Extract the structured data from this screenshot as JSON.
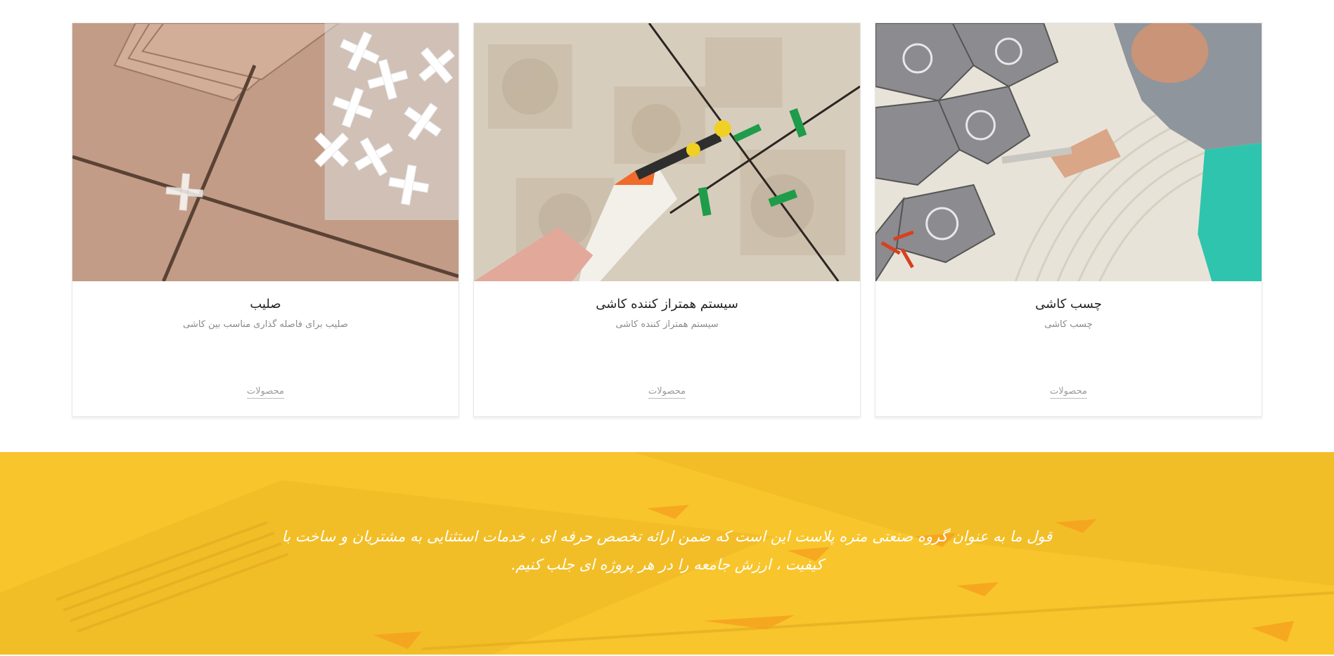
{
  "cards": [
    {
      "title": "صلیب",
      "description": "صلیب برای فاصله گذاری مناسب بین کاشی",
      "link_label": "محصولات",
      "image_icon": "tile-spacer-crosses-image"
    },
    {
      "title": "سیستم همتراز کننده کاشی",
      "description": "سیستم همتراز کننده کاشی",
      "link_label": "محصولات",
      "image_icon": "tile-leveling-system-image"
    },
    {
      "title": "چسب کاشی",
      "description": "چسب کاشی",
      "link_label": "محصولات",
      "image_icon": "tile-adhesive-image"
    }
  ],
  "banner": {
    "text": "قول ما به عنوان گروه صنعتی متره پلاست این است که ضمن ارائه تخصص حرفه ای ، خدمات استثنایی به مشتریان و ساخت با کیفیت ، ارزش جامعه را در هر پروژه ای جلب کنیم.",
    "background_color": "#f8c52c"
  }
}
